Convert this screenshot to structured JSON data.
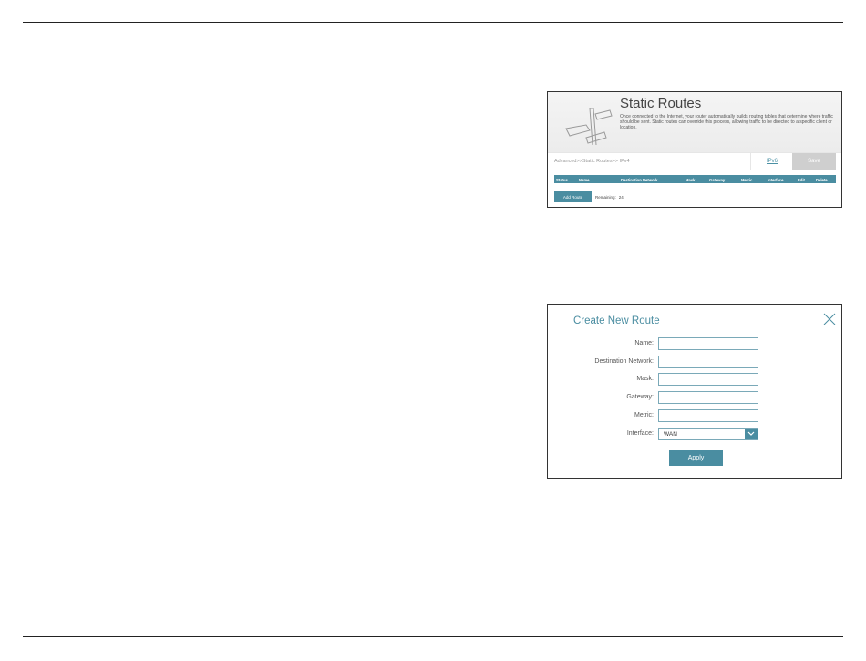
{
  "static_routes": {
    "title": "Static Routes",
    "description": "Once connected to the Internet, your router automatically builds routing tables that determine where traffic should be sent. Static routes can override this process, allowing traffic to be directed to a specific client or location.",
    "breadcrumb": "Advanced>>Static Routes>> IPv4",
    "ipv6_label": "IPv6",
    "save_label": "Save",
    "columns": [
      "Status",
      "Name",
      "Destination Network",
      "Mask",
      "Gateway",
      "Metric",
      "Interface",
      "Edit",
      "Delete"
    ],
    "add_route_label": "Add Route",
    "remaining_label": "Remaining:",
    "remaining_count": "24"
  },
  "create_route": {
    "title": "Create New Route",
    "fields": [
      {
        "label": "Name:",
        "value": ""
      },
      {
        "label": "Destination Network:",
        "value": ""
      },
      {
        "label": "Mask:",
        "value": ""
      },
      {
        "label": "Gateway:",
        "value": ""
      },
      {
        "label": "Metric:",
        "value": ""
      }
    ],
    "interface_label": "Interface:",
    "interface_value": "WAN",
    "apply_label": "Apply"
  },
  "colors": {
    "accent": "#4a8da1",
    "save_disabled": "#cfcfcf"
  },
  "icons": {
    "signpost": "signpost-icon",
    "close": "close-icon",
    "dropdown": "chevron-down-icon"
  }
}
